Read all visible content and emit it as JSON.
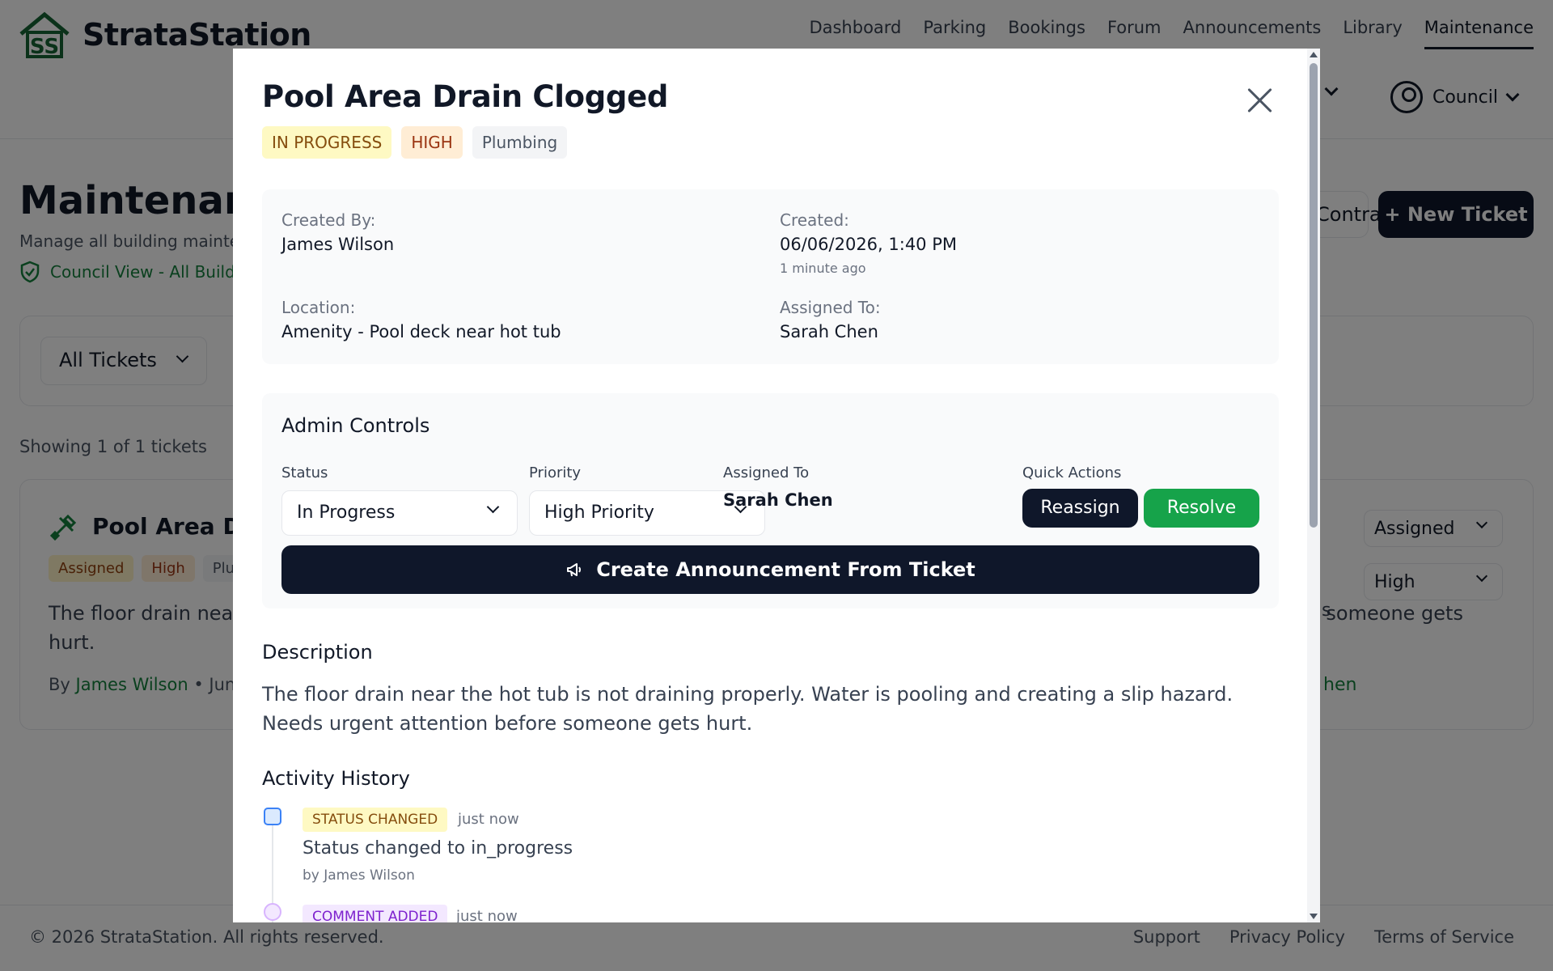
{
  "app": {
    "brand": "StrataStation",
    "nav": [
      "Dashboard",
      "Parking",
      "Bookings",
      "Forum",
      "Announcements",
      "Library",
      "Maintenance"
    ],
    "user_role": "Council"
  },
  "page": {
    "title": "Maintenance",
    "subtitle": "Manage all building maintenance",
    "council_view": "Council View - All Buildings",
    "btn_contractors": "Contractors",
    "btn_new_ticket": "+ New Ticket",
    "filter_label": "All Tickets",
    "showing": "Showing 1 of 1 tickets"
  },
  "ticket_card": {
    "title": "Pool Area Drain Clogged",
    "badges": [
      "Assigned",
      "High",
      "Plumbing"
    ],
    "description": "The floor drain near the hot tub is not draining properly. Water is pooling and creating a slip hazard. Needs urgent attention before someone gets hurt.",
    "by_label": "By",
    "author": "James Wilson",
    "date": "• Jun",
    "status_select": "Assigned",
    "priority_select": "High",
    "assignee_fragment": "hen",
    "desc_fragment": "s"
  },
  "modal": {
    "title": "Pool Area Drain Clogged",
    "status_badge": "IN PROGRESS",
    "priority_badge": "HIGH",
    "category_badge": "Plumbing",
    "info": {
      "created_by_label": "Created By:",
      "created_by": "James Wilson",
      "created_label": "Created:",
      "created": "06/06/2026, 1:40 PM",
      "created_ago": "1 minute ago",
      "location_label": "Location:",
      "location": "Amenity - Pool deck near hot tub",
      "assigned_label": "Assigned To:",
      "assigned": "Sarah Chen"
    },
    "admin": {
      "title": "Admin Controls",
      "status_label": "Status",
      "status_value": "In Progress",
      "priority_label": "Priority",
      "priority_value": "High Priority",
      "assigned_label": "Assigned To",
      "assigned_value": "Sarah Chen",
      "quick_label": "Quick Actions",
      "reassign": "Reassign",
      "resolve": "Resolve",
      "announce": "Create Announcement From Ticket"
    },
    "description_title": "Description",
    "description": "The floor drain near the hot tub is not draining properly. Water is pooling and creating a slip hazard. Needs urgent attention before someone gets hurt.",
    "activity_title": "Activity History",
    "activity": [
      {
        "type": "STATUS CHANGED",
        "time": "just now",
        "text": "Status changed to in_progress",
        "by": "by James Wilson"
      },
      {
        "type": "COMMENT ADDED",
        "time": "just now"
      }
    ]
  },
  "footer": {
    "copyright": "© 2026 StrataStation. All rights reserved.",
    "links": [
      "Support",
      "Privacy Policy",
      "Terms of Service"
    ]
  },
  "colors": {
    "primary": "#0f172a",
    "accent_green": "#16a34a",
    "badge_yellow": "#fef9c3",
    "badge_orange": "#ffedd5"
  }
}
